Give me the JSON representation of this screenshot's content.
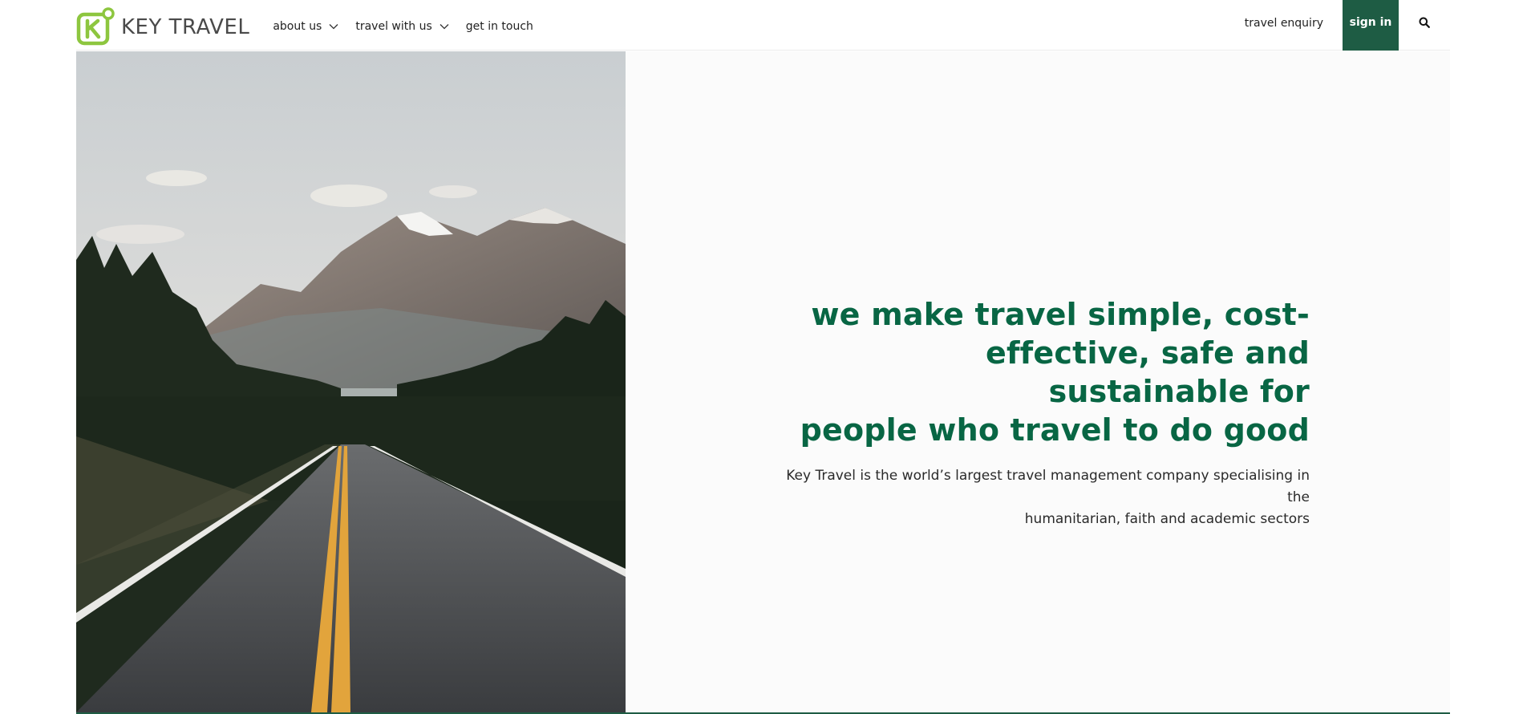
{
  "brand": {
    "name": "KEY TRAVEL",
    "accent": "#8dc63f",
    "primary": "#1e5c44",
    "headline_color": "#086644"
  },
  "nav": {
    "items": [
      {
        "label": "about us",
        "has_dropdown": true
      },
      {
        "label": "travel with us",
        "has_dropdown": true
      },
      {
        "label": "get in touch",
        "has_dropdown": false
      }
    ],
    "enquiry_label": "travel enquiry",
    "signin_label": "sign in",
    "search_icon": "search-icon"
  },
  "hero": {
    "image": "mountain-road",
    "headline_lines": [
      "we make travel simple, cost-",
      "effective, safe and sustainable for",
      "people who travel to do good"
    ],
    "subline_lines": [
      "Key Travel is the world’s largest travel management company specialising in the",
      "humanitarian, faith and academic sectors"
    ]
  }
}
